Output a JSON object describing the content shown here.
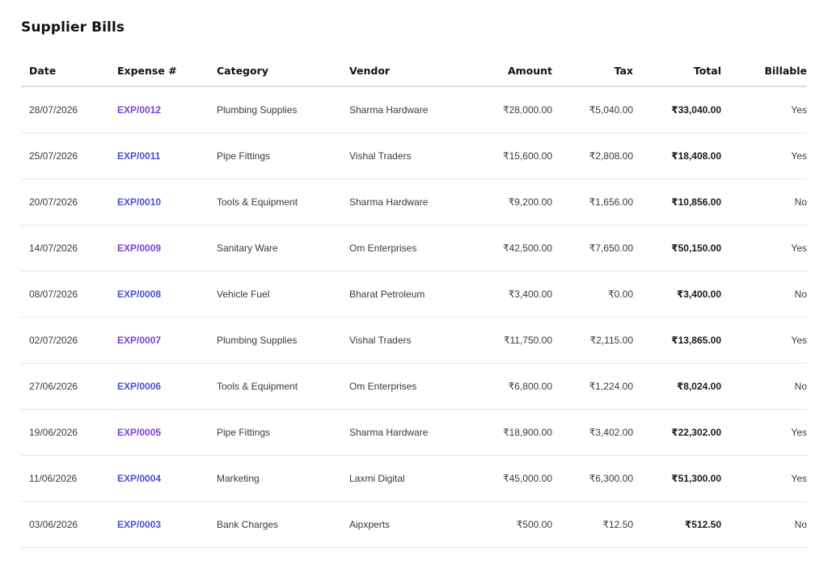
{
  "page": {
    "title": "Supplier Bills"
  },
  "table": {
    "headers": {
      "date": "Date",
      "expense": "Expense #",
      "category": "Category",
      "vendor": "Vendor",
      "amount": "Amount",
      "tax": "Tax",
      "total": "Total",
      "billable": "Billable"
    },
    "rows": [
      {
        "date": "28/07/2026",
        "expense": "EXP/0012",
        "category": "Plumbing Supplies",
        "vendor": "Sharma Hardware",
        "amount": "₹28,000.00",
        "tax": "₹5,040.00",
        "total": "₹33,040.00",
        "billable": "Yes"
      },
      {
        "date": "25/07/2026",
        "expense": "EXP/0011",
        "category": "Pipe Fittings",
        "vendor": "Vishal Traders",
        "amount": "₹15,600.00",
        "tax": "₹2,808.00",
        "total": "₹18,408.00",
        "billable": "Yes"
      },
      {
        "date": "20/07/2026",
        "expense": "EXP/0010",
        "category": "Tools & Equipment",
        "vendor": "Sharma Hardware",
        "amount": "₹9,200.00",
        "tax": "₹1,656.00",
        "total": "₹10,856.00",
        "billable": "No"
      },
      {
        "date": "14/07/2026",
        "expense": "EXP/0009",
        "category": "Sanitary Ware",
        "vendor": "Om Enterprises",
        "amount": "₹42,500.00",
        "tax": "₹7,650.00",
        "total": "₹50,150.00",
        "billable": "Yes"
      },
      {
        "date": "08/07/2026",
        "expense": "EXP/0008",
        "category": "Vehicle Fuel",
        "vendor": "Bharat Petroleum",
        "amount": "₹3,400.00",
        "tax": "₹0.00",
        "total": "₹3,400.00",
        "billable": "No"
      },
      {
        "date": "02/07/2026",
        "expense": "EXP/0007",
        "category": "Plumbing Supplies",
        "vendor": "Vishal Traders",
        "amount": "₹11,750.00",
        "tax": "₹2,115.00",
        "total": "₹13,865.00",
        "billable": "Yes"
      },
      {
        "date": "27/06/2026",
        "expense": "EXP/0006",
        "category": "Tools & Equipment",
        "vendor": "Om Enterprises",
        "amount": "₹6,800.00",
        "tax": "₹1,224.00",
        "total": "₹8,024.00",
        "billable": "No"
      },
      {
        "date": "19/06/2026",
        "expense": "EXP/0005",
        "category": "Pipe Fittings",
        "vendor": "Sharma Hardware",
        "amount": "₹18,900.00",
        "tax": "₹3,402.00",
        "total": "₹22,302.00",
        "billable": "Yes"
      },
      {
        "date": "11/06/2026",
        "expense": "EXP/0004",
        "category": "Marketing",
        "vendor": "Laxmi Digital",
        "amount": "₹45,000.00",
        "tax": "₹6,300.00",
        "total": "₹51,300.00",
        "billable": "Yes"
      },
      {
        "date": "03/06/2026",
        "expense": "EXP/0003",
        "category": "Bank Charges",
        "vendor": "Aipxperts",
        "amount": "₹500.00",
        "tax": "₹12.50",
        "total": "₹512.50",
        "billable": "No"
      }
    ]
  },
  "colors": {
    "link_primary": "#7b3fd6",
    "link_alt": "#4a4fd6",
    "divider": "#e6e6e6"
  }
}
